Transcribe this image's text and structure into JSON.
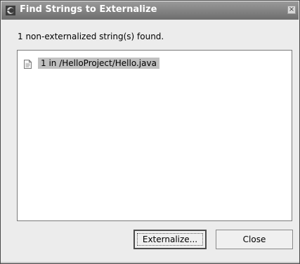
{
  "window": {
    "title": "Find Strings to Externalize",
    "close_glyph": "×",
    "icon": "eclipse-window-icon"
  },
  "status": {
    "text": "1 non-externalized string(s) found."
  },
  "results": {
    "items": [
      {
        "label": "1 in /HelloProject/Hello.java",
        "icon": "java-file-icon",
        "selected": true
      }
    ]
  },
  "buttons": {
    "externalize_label": "Externalize...",
    "close_label": "Close"
  },
  "colors": {
    "titlebar": "#7a7a7a",
    "title_text": "#ffffff",
    "dialog_background": "#ececec",
    "selection": "#c0c0c0"
  }
}
